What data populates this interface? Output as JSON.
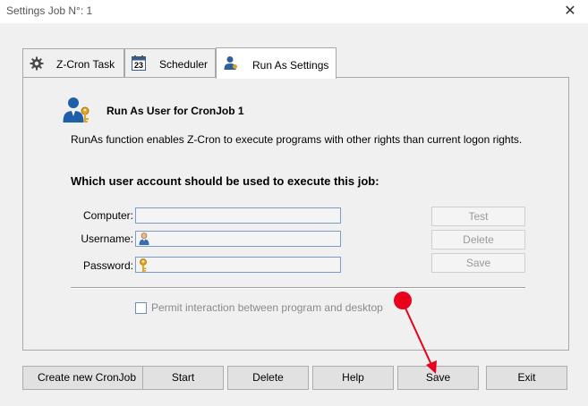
{
  "window": {
    "title": "Settings Job N°: 1",
    "close_glyph": "✕"
  },
  "tabs": [
    {
      "label": "Z-Cron Task",
      "icon": "gear-icon"
    },
    {
      "label": "Scheduler",
      "icon": "calendar-icon",
      "calendar_day": "23"
    },
    {
      "label": "Run As Settings",
      "icon": "user-settings-icon",
      "active": true
    }
  ],
  "runas": {
    "title": "Run As User for CronJob 1",
    "description": "RunAs function enables Z-Cron to execute programs with other rights than current logon rights.",
    "question": "Which user account should be used to execute this job:",
    "fields": {
      "computer_label": "Computer:",
      "computer_value": "",
      "username_label": "Username:",
      "username_value": "",
      "password_label": "Password:",
      "password_value": ""
    },
    "side_buttons": {
      "test": "Test",
      "delete": "Delete",
      "save": "Save"
    },
    "checkbox": {
      "label": "Permit interaction between program and desktop",
      "checked": false
    }
  },
  "footer_buttons": {
    "create": "Create new CronJob",
    "start": "Start",
    "delete": "Delete",
    "help": "Help",
    "save": "Save",
    "exit": "Exit"
  },
  "annotation": {
    "color": "#e8001c"
  }
}
